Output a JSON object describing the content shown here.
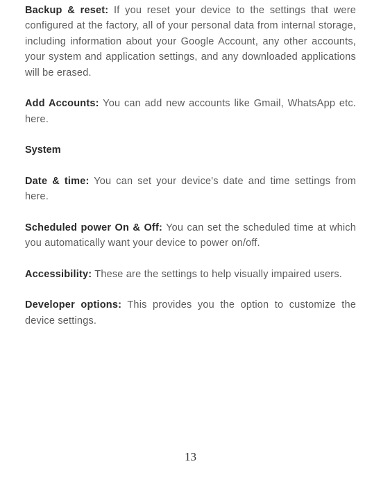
{
  "paragraphs": {
    "backup_reset": {
      "label": "Backup & reset:",
      "text": " If you reset your device to the settings that were configured at the factory, all of your personal data from internal storage, including information about your Google Account, any other accounts, your system and application settings, and any downloaded applications will be erased."
    },
    "add_accounts": {
      "label": "Add Accounts:",
      "text": " You can add new accounts like Gmail, WhatsApp etc. here."
    },
    "system_title": "System",
    "date_time": {
      "label": "Date & time:",
      "text": " You can set your device's date and time settings from here."
    },
    "scheduled_power": {
      "label": "Scheduled power On & Off:",
      "text": " You can set the scheduled time at which you automatically want your device to power on/off."
    },
    "accessibility": {
      "label": "Accessibility:",
      "text": " These are the settings to help visually impaired users."
    },
    "developer_options": {
      "label": "Developer options:",
      "text": " This provides you the option to customize the device settings."
    }
  },
  "page_number": "13"
}
